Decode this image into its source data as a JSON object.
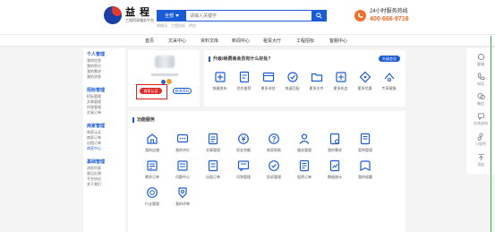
{
  "header": {
    "logo_name": "益 程",
    "logo_slogan": "工程招采服务平台",
    "search": {
      "type": "全部",
      "placeholder": "请输入关键字",
      "hot_words": [
        "热搜词",
        "工程招标",
        "供应"
      ]
    },
    "hotline": {
      "label": "24小时服务热线",
      "number": "400-666-9716"
    }
  },
  "nav": [
    "首页",
    "文采中心",
    "资料文库",
    "新闻中心",
    "租赁大厅",
    "工程招标",
    "客服中心"
  ],
  "sidebar": [
    {
      "title": "个人管理",
      "items": [
        "我的信息",
        "我的积分",
        "我的需求",
        "我的消息"
      ]
    },
    {
      "title": "招标管理",
      "items": [
        "招标管理",
        "文章管理",
        "问答管理",
        "交易订单"
      ]
    },
    {
      "title": "商家管理",
      "items": [
        "商家认证",
        "商家订单",
        "出租订单",
        "商家中心"
      ]
    },
    {
      "title": "基础管理",
      "items": [
        "消息列表",
        "意见反馈",
        "平台协议",
        "关于我们"
      ]
    }
  ],
  "profile": {
    "btn_primary": "商家认证",
    "btn_secondary": "修改资料"
  },
  "upgrade": {
    "title": "升级/续费商会员有什么好处?",
    "pill": "升级会员",
    "features": [
      {
        "label": "快捷发布",
        "icon": "quick-publish-icon"
      },
      {
        "label": "优先推荐",
        "icon": "recommend-icon"
      },
      {
        "label": "更多浏览",
        "icon": "browse-icon"
      },
      {
        "label": "快速匹配",
        "icon": "match-icon"
      },
      {
        "label": "更多文件",
        "icon": "folder-icon"
      },
      {
        "label": "更多机会",
        "icon": "opportunity-icon"
      },
      {
        "label": "更多优惠",
        "icon": "tag-icon"
      },
      {
        "label": "专享客服",
        "icon": "service-icon"
      }
    ]
  },
  "services": {
    "title": "功能服务",
    "items": [
      {
        "label": "我的店铺",
        "icon": "shop-icon"
      },
      {
        "label": "我的评价",
        "icon": "comment-icon"
      },
      {
        "label": "文章管理",
        "icon": "article-icon"
      },
      {
        "label": "资金余额",
        "icon": "money-icon"
      },
      {
        "label": "商家帮助",
        "icon": "help-icon"
      },
      {
        "label": "服务管理",
        "icon": "user-service-icon"
      },
      {
        "label": "我的需求",
        "icon": "demand-icon"
      },
      {
        "label": "案例管理",
        "icon": "case-icon"
      },
      {
        "label": "需求订单",
        "icon": "order-icon"
      },
      {
        "label": "问题中心",
        "icon": "question-icon"
      },
      {
        "label": "出租订单",
        "icon": "rent-order-icon"
      },
      {
        "label": "问答管理",
        "icon": "qa-icon"
      },
      {
        "label": "投诉管理",
        "icon": "complaint-icon"
      },
      {
        "label": "租赁订单",
        "icon": "lease-icon"
      },
      {
        "label": "数据统计",
        "icon": "stats-icon"
      },
      {
        "label": "我的收藏",
        "icon": "favorite-icon"
      },
      {
        "label": "行业管理",
        "icon": "industry-icon"
      },
      {
        "label": "我的评审",
        "icon": "review-icon"
      }
    ]
  },
  "floatbar": [
    "客服",
    "电话",
    "微信",
    "在线咨询",
    "小程序",
    "顶部"
  ],
  "colors": {
    "primary": "#1a5cd6",
    "accent": "#e02a2a",
    "hotline": "#f06a26"
  }
}
